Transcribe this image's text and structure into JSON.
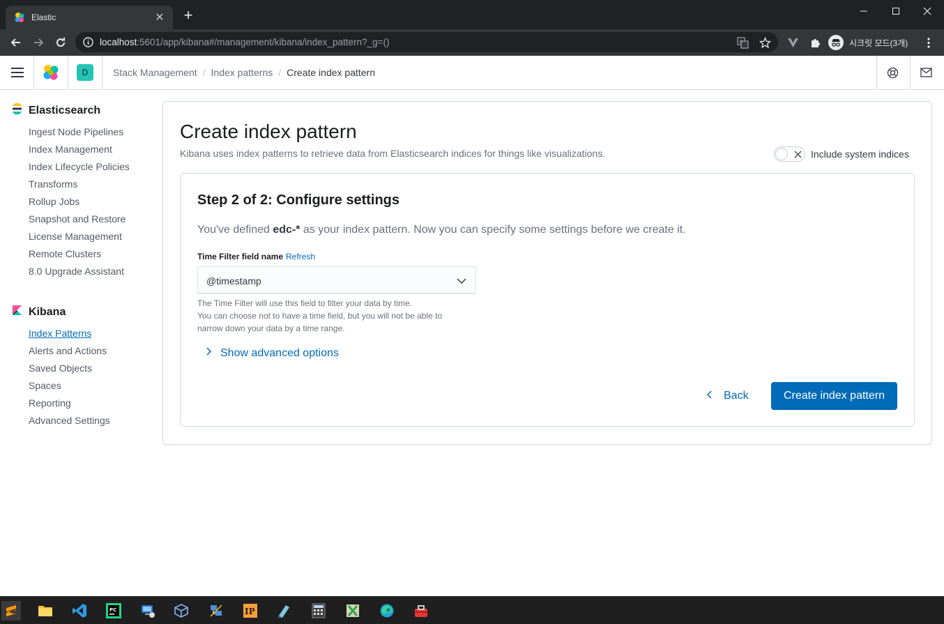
{
  "browser": {
    "tab_title": "Elastic",
    "tab_close_glyph": "✕",
    "new_tab_glyph": "+",
    "url_host": "localhost",
    "url_rest": ":5601/app/kibana#/management/kibana/index_pattern?_g=()",
    "incognito_label": "시크릿 모드(3개)"
  },
  "header": {
    "space_initial": "D",
    "breadcrumbs": [
      "Stack Management",
      "Index patterns",
      "Create index pattern"
    ],
    "breadcrumb_separator": "/"
  },
  "sidebar": {
    "elasticsearch": {
      "title": "Elasticsearch",
      "items": [
        "Ingest Node Pipelines",
        "Index Management",
        "Index Lifecycle Policies",
        "Transforms",
        "Rollup Jobs",
        "Snapshot and Restore",
        "License Management",
        "Remote Clusters",
        "8.0 Upgrade Assistant"
      ]
    },
    "kibana": {
      "title": "Kibana",
      "items": [
        "Index Patterns",
        "Alerts and Actions",
        "Saved Objects",
        "Spaces",
        "Reporting",
        "Advanced Settings"
      ],
      "active_item": "Index Patterns"
    }
  },
  "main": {
    "title": "Create index pattern",
    "description": "Kibana uses index patterns to retrieve data from Elasticsearch indices for things like visualizations.",
    "system_indices_label": "Include system indices",
    "system_indices_enabled": false,
    "step": {
      "title": "Step 2 of 2: Configure settings",
      "desc_prefix": "You've defined ",
      "index_pattern": "edc-*",
      "desc_suffix": " as your index pattern. Now you can specify some settings before we create it.",
      "field_label": "Time Filter field name",
      "refresh_label": "Refresh",
      "selected_field": "@timestamp",
      "help_lines": [
        "The Time Filter will use this field to filter your data by time.",
        "You can choose not to have a time field, but you will not be able to",
        "narrow down your data by a time range."
      ],
      "advanced_label": "Show advanced options",
      "back_label": "Back",
      "create_label": "Create index pattern"
    }
  },
  "colors": {
    "primary": "#006bb8",
    "chrome_dark": "#202124",
    "chrome_toolbar": "#35363a",
    "space_avatar": "#24c4b4",
    "taskbar": "#1f1f1f"
  }
}
